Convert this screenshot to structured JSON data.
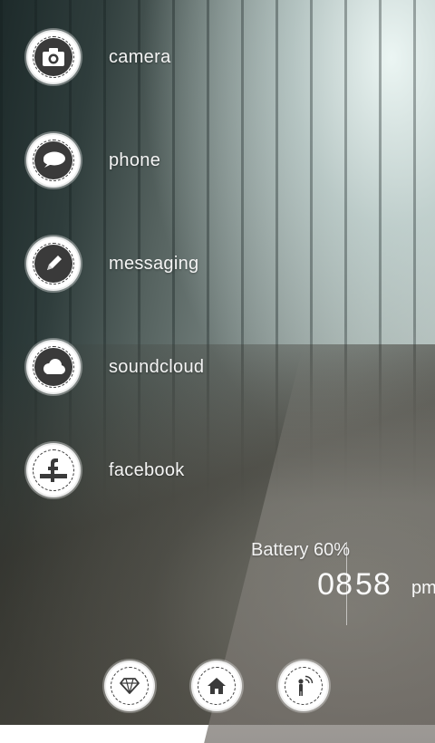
{
  "apps": [
    {
      "label": "camera",
      "icon": "camera-icon"
    },
    {
      "label": "phone",
      "icon": "chat-bubble-icon"
    },
    {
      "label": "messaging",
      "icon": "pencil-icon"
    },
    {
      "label": "soundcloud",
      "icon": "cloud-icon"
    },
    {
      "label": "facebook",
      "icon": "facebook-icon"
    }
  ],
  "status": {
    "battery": "Battery 60%",
    "hours": "08",
    "minutes": "58",
    "ampm": "pm"
  },
  "dock": [
    {
      "icon": "diamond-icon"
    },
    {
      "icon": "home-icon"
    },
    {
      "icon": "person-wifi-icon"
    }
  ],
  "colors": {
    "icon_dark": "#3a3a3a",
    "badge": "#ffffff",
    "text": "#f4f4f4"
  }
}
